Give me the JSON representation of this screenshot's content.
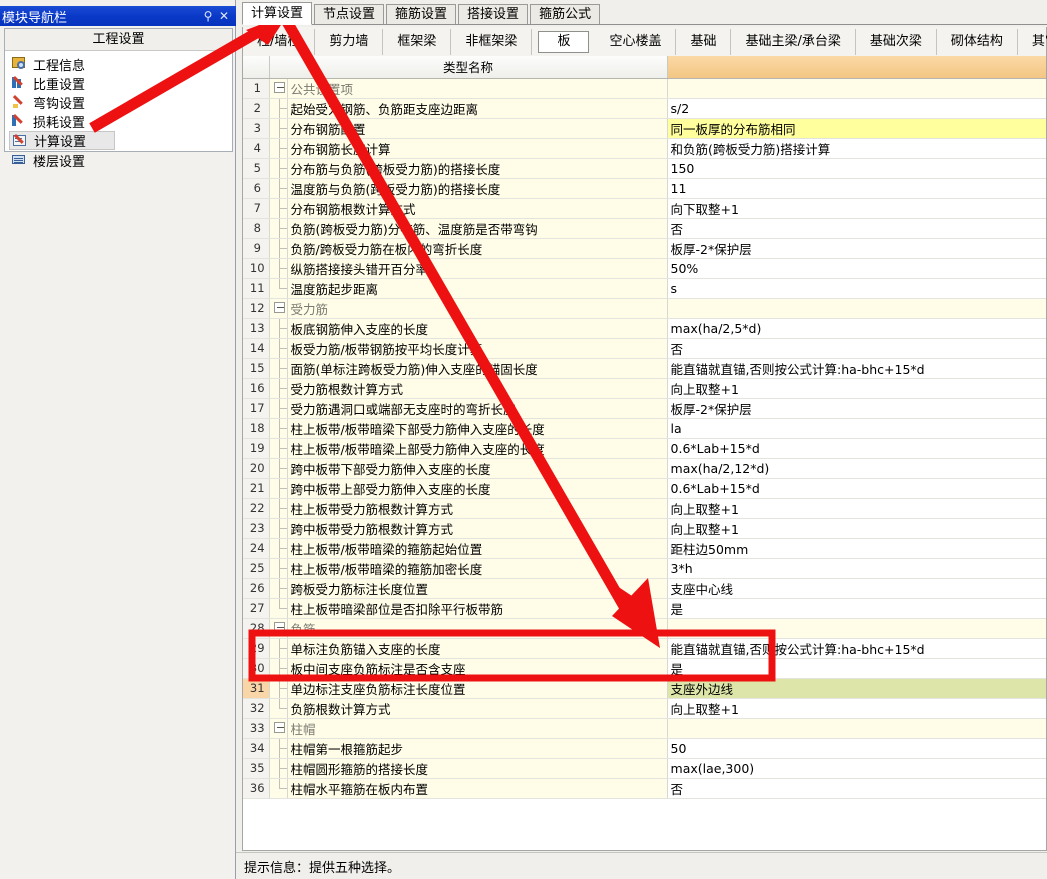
{
  "nav_panel": {
    "title": "模块导航栏",
    "pin_icon": "pin-icon",
    "close_icon": "close-icon",
    "group_header": "工程设置",
    "items": [
      {
        "label": "工程信息",
        "icon": "project-info-icon",
        "selected": false
      },
      {
        "label": "比重设置",
        "icon": "weight-ratio-icon",
        "selected": false
      },
      {
        "label": "弯钩设置",
        "icon": "hook-icon",
        "selected": false
      },
      {
        "label": "损耗设置",
        "icon": "loss-icon",
        "selected": false
      },
      {
        "label": "计算设置",
        "icon": "calc-settings-icon",
        "selected": true
      },
      {
        "label": "楼层设置",
        "icon": "floor-settings-icon",
        "selected": false
      }
    ]
  },
  "primary_tabs": [
    {
      "label": "计算设置",
      "active": true
    },
    {
      "label": "节点设置",
      "active": false
    },
    {
      "label": "箍筋设置",
      "active": false
    },
    {
      "label": "搭接设置",
      "active": false
    },
    {
      "label": "箍筋公式",
      "active": false
    }
  ],
  "secondary_tabs": [
    {
      "label": "柱/墙柱",
      "active": false
    },
    {
      "label": "剪力墙",
      "active": false
    },
    {
      "label": "框架梁",
      "active": false
    },
    {
      "label": "非框架梁",
      "active": false
    },
    {
      "label": "板",
      "active": true
    },
    {
      "label": "空心楼盖",
      "active": false
    },
    {
      "label": "基础",
      "active": false
    },
    {
      "label": "基础主梁/承台梁",
      "active": false
    },
    {
      "label": "基础次梁",
      "active": false
    },
    {
      "label": "砌体结构",
      "active": false
    },
    {
      "label": "其它",
      "active": false
    }
  ],
  "grid": {
    "headers": {
      "num": "",
      "name": "类型名称",
      "value": ""
    },
    "rows": [
      {
        "n": "1",
        "kind": "group",
        "name": "公共设置项",
        "value": ""
      },
      {
        "n": "2",
        "kind": "item",
        "name": "起始受力钢筋、负筋距支座边距离",
        "value": "s/2"
      },
      {
        "n": "3",
        "kind": "item",
        "name": "分布钢筋配置",
        "value": "同一板厚的分布筋相同",
        "hl": "yellow"
      },
      {
        "n": "4",
        "kind": "item",
        "name": "分布钢筋长度计算",
        "value": "和负筋(跨板受力筋)搭接计算"
      },
      {
        "n": "5",
        "kind": "item",
        "name": "分布筋与负筋(跨板受力筋)的搭接长度",
        "value": "150"
      },
      {
        "n": "6",
        "kind": "item",
        "name": "温度筋与负筋(跨板受力筋)的搭接长度",
        "value": "11"
      },
      {
        "n": "7",
        "kind": "item",
        "name": "分布钢筋根数计算方式",
        "value": "向下取整+1"
      },
      {
        "n": "8",
        "kind": "item",
        "name": "负筋(跨板受力筋)分布筋、温度筋是否带弯钩",
        "value": "否"
      },
      {
        "n": "9",
        "kind": "item",
        "name": "负筋/跨板受力筋在板内的弯折长度",
        "value": "板厚-2*保护层"
      },
      {
        "n": "10",
        "kind": "item",
        "name": "纵筋搭接接头错开百分率",
        "value": "50%"
      },
      {
        "n": "11",
        "kind": "item-last",
        "name": "温度筋起步距离",
        "value": "s"
      },
      {
        "n": "12",
        "kind": "group",
        "name": "受力筋",
        "value": ""
      },
      {
        "n": "13",
        "kind": "item",
        "name": "板底钢筋伸入支座的长度",
        "value": "max(ha/2,5*d)"
      },
      {
        "n": "14",
        "kind": "item",
        "name": "板受力筋/板带钢筋按平均长度计算",
        "value": "否"
      },
      {
        "n": "15",
        "kind": "item",
        "name": "面筋(单标注跨板受力筋)伸入支座的锚固长度",
        "value": "能直锚就直锚,否则按公式计算:ha-bhc+15*d"
      },
      {
        "n": "16",
        "kind": "item",
        "name": "受力筋根数计算方式",
        "value": "向上取整+1"
      },
      {
        "n": "17",
        "kind": "item",
        "name": "受力筋遇洞口或端部无支座时的弯折长度",
        "value": "板厚-2*保护层"
      },
      {
        "n": "18",
        "kind": "item",
        "name": "柱上板带/板带暗梁下部受力筋伸入支座的长度",
        "value": "la"
      },
      {
        "n": "19",
        "kind": "item",
        "name": "柱上板带/板带暗梁上部受力筋伸入支座的长度",
        "value": "0.6*Lab+15*d"
      },
      {
        "n": "20",
        "kind": "item",
        "name": "跨中板带下部受力筋伸入支座的长度",
        "value": "max(ha/2,12*d)"
      },
      {
        "n": "21",
        "kind": "item",
        "name": "跨中板带上部受力筋伸入支座的长度",
        "value": "0.6*Lab+15*d"
      },
      {
        "n": "22",
        "kind": "item",
        "name": "柱上板带受力筋根数计算方式",
        "value": "向上取整+1"
      },
      {
        "n": "23",
        "kind": "item",
        "name": "跨中板带受力筋根数计算方式",
        "value": "向上取整+1"
      },
      {
        "n": "24",
        "kind": "item",
        "name": "柱上板带/板带暗梁的箍筋起始位置",
        "value": "距柱边50mm"
      },
      {
        "n": "25",
        "kind": "item",
        "name": "柱上板带/板带暗梁的箍筋加密长度",
        "value": "3*h"
      },
      {
        "n": "26",
        "kind": "item",
        "name": "跨板受力筋标注长度位置",
        "value": "支座中心线"
      },
      {
        "n": "27",
        "kind": "item-last",
        "name": "柱上板带暗梁部位是否扣除平行板带筋",
        "value": "是"
      },
      {
        "n": "28",
        "kind": "group",
        "name": "负筋",
        "value": ""
      },
      {
        "n": "29",
        "kind": "item",
        "name": "单标注负筋锚入支座的长度",
        "value": "能直锚就直锚,否则按公式计算:ha-bhc+15*d"
      },
      {
        "n": "30",
        "kind": "item",
        "name": "板中间支座负筋标注是否含支座",
        "value": "是"
      },
      {
        "n": "31",
        "kind": "item",
        "name": "单边标注支座负筋标注长度位置",
        "value": "支座外边线",
        "hl": "green",
        "current": true
      },
      {
        "n": "32",
        "kind": "item-last",
        "name": "负筋根数计算方式",
        "value": "向上取整+1"
      },
      {
        "n": "33",
        "kind": "group",
        "name": "柱帽",
        "value": ""
      },
      {
        "n": "34",
        "kind": "item",
        "name": "柱帽第一根箍筋起步",
        "value": "50"
      },
      {
        "n": "35",
        "kind": "item",
        "name": "柱帽圆形箍筋的搭接长度",
        "value": "max(lae,300)"
      },
      {
        "n": "36",
        "kind": "item-last",
        "name": "柱帽水平箍筋在板内布置",
        "value": "否"
      }
    ]
  },
  "status_bar": {
    "text": "提示信息：提供五种选择。"
  },
  "annotations": {
    "arrow_color": "#ee1111",
    "highlight_box_color": "#ee1111",
    "arrow_1_target": "计算设置",
    "arrow_2_target": "单边标注支座负筋标注长度位置",
    "box_target_rows": [
      "30",
      "31"
    ]
  },
  "colors": {
    "title_bar": "#0a39c8",
    "row_name_bg": "#fffde8",
    "highlight_yellow": "#ffff9e",
    "highlight_green": "#dde6a8",
    "header_value_bg": "#f3c684",
    "current_row_num_bg": "#f9d6a8"
  }
}
